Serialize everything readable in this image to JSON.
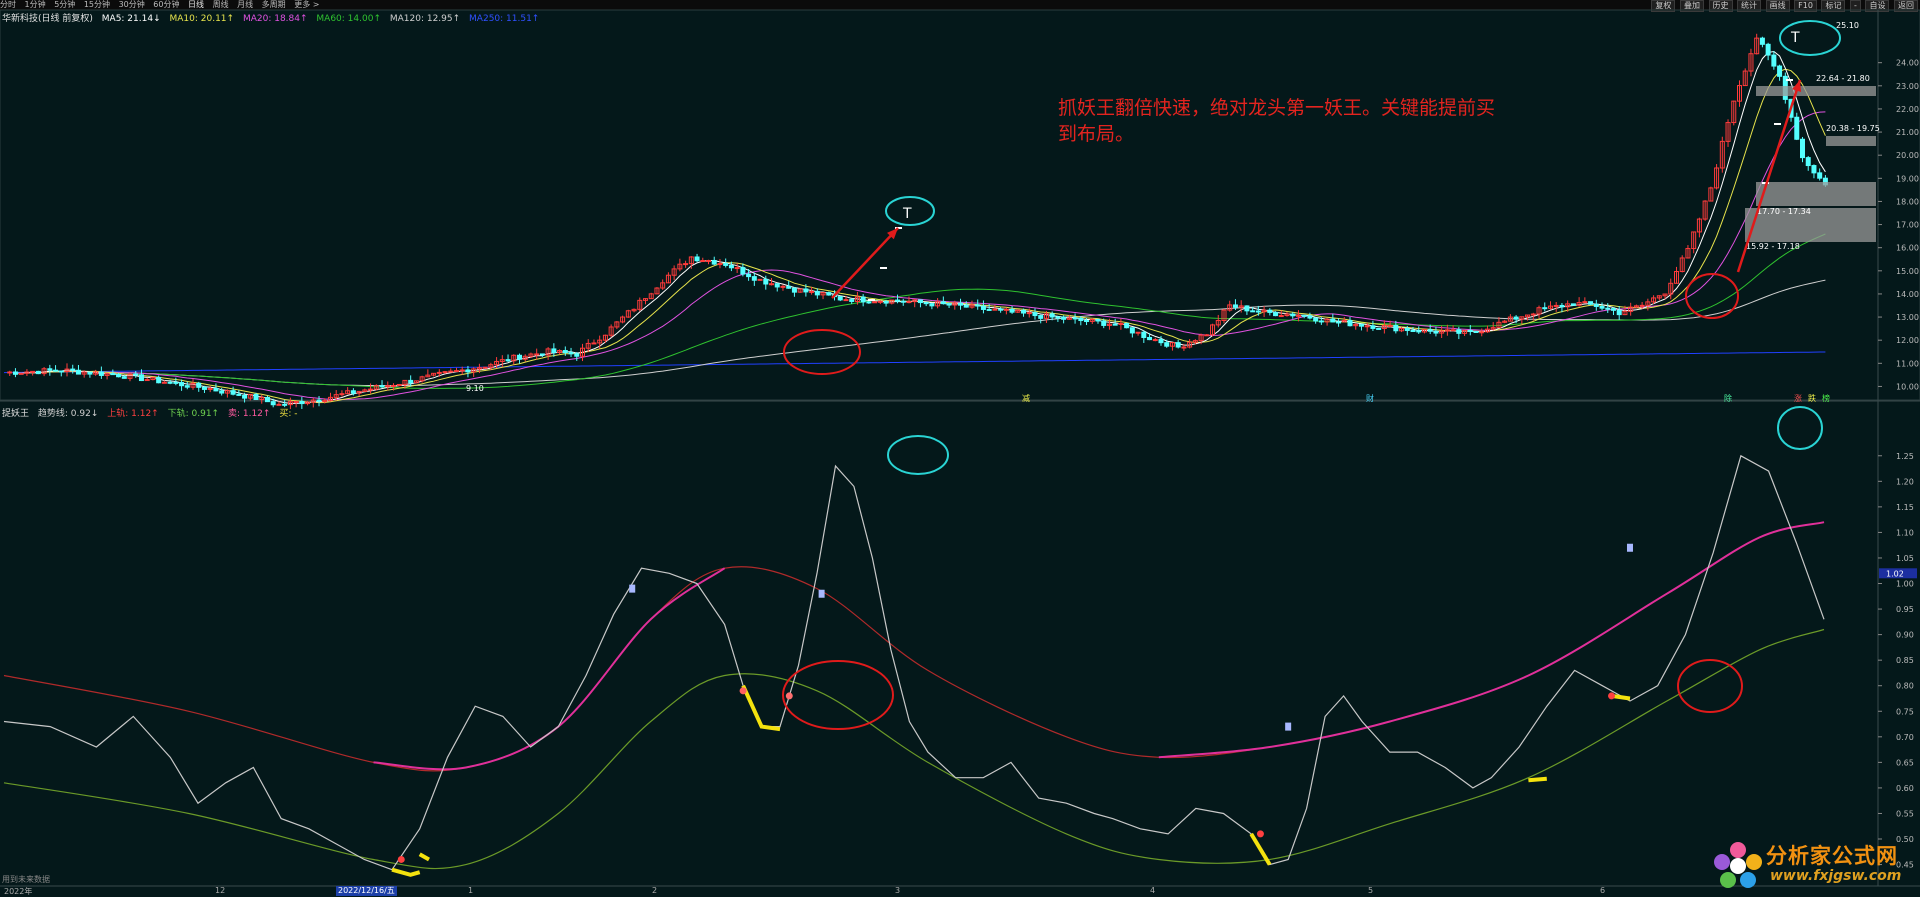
{
  "toolbar": {
    "periods": [
      "分时",
      "1分钟",
      "5分钟",
      "15分钟",
      "30分钟",
      "60分钟",
      "日线",
      "周线",
      "月线",
      "多周期",
      "更多 >"
    ],
    "active_period": "日线",
    "right_buttons": [
      "复权",
      "叠加",
      "历史",
      "统计",
      "画线",
      "F10",
      "标记",
      "-",
      "自设",
      "返回"
    ]
  },
  "main_header": {
    "stock": "华新科技(日线 前复权)",
    "ma5": "MA5: 21.14↓",
    "ma10": "MA10: 20.11↑",
    "ma20": "MA20: 18.84↑",
    "ma60": "MA60: 14.00↑",
    "ma120": "MA120: 12.95↑",
    "ma250": "MA250: 11.51↑"
  },
  "sub_header": {
    "name": "捉妖王",
    "trend": "趋势线: 0.92↓",
    "upper": "上轨: 1.12↑",
    "lower": "下轨: 0.91↑",
    "sell": "卖: 1.12↑",
    "buy": "买: -"
  },
  "annotation": "抓妖王翻倍快速，绝对龙头第一妖王。关键能提前买到布局。",
  "bottom_note": "用到未来数据",
  "date_box": "2022/12/16/五",
  "x_labels": [
    {
      "t": "2022年",
      "x": 4
    },
    {
      "t": "12",
      "x": 215
    },
    {
      "t": "1",
      "x": 468
    },
    {
      "t": "2",
      "x": 652
    },
    {
      "t": "3",
      "x": 895
    },
    {
      "t": "4",
      "x": 1150
    },
    {
      "t": "5",
      "x": 1368
    },
    {
      "t": "6",
      "x": 1600
    }
  ],
  "main_markers": [
    {
      "t": "减",
      "x": 1022,
      "c": "#f0f04a"
    },
    {
      "t": "财",
      "x": 1366,
      "c": "#4ad8ff"
    },
    {
      "t": "除",
      "x": 1724,
      "c": "#4af0a0"
    },
    {
      "t": "涨",
      "x": 1794,
      "c": "#ff5050"
    },
    {
      "t": "跌",
      "x": 1808,
      "c": "#f0f04a"
    },
    {
      "t": "榜",
      "x": 1822,
      "c": "#4af04a"
    }
  ],
  "price_labels": [
    {
      "t": "25.10",
      "x": 1836,
      "y": 28
    },
    {
      "t": "22.64 - 21.80",
      "x": 1816,
      "y": 81
    },
    {
      "t": "20.38 - 19.75",
      "x": 1826,
      "y": 131
    },
    {
      "t": "17.70 - 17.34",
      "x": 1757,
      "y": 214
    },
    {
      "t": "15.92 - 17.18",
      "x": 1746,
      "y": 249
    },
    {
      "t": "9.10",
      "x": 466,
      "y": 391
    }
  ],
  "watermark": {
    "name": "分析家公式网",
    "url": "www.fxjgsw.com"
  },
  "cursor_value": "1.02",
  "colors": {
    "background": "#04181a",
    "up": "#ff3b3b",
    "down": "#54ffff",
    "ma5": "#ffffff",
    "ma10": "#e7e34c",
    "ma20": "#e052e0",
    "ma60": "#2fc22f",
    "ma120": "#cfcfcf",
    "ma250": "#2040ff",
    "highlight": "#e01b1b",
    "cyan_circle": "#2ad4d4",
    "annotation": "#e3241f"
  },
  "chart_data": [
    {
      "type": "candlestick",
      "title": "华新科技(日线 前复权)",
      "ylim": [
        9.5,
        25.5
      ],
      "y_ticks": [
        10,
        11,
        12,
        13,
        14,
        15,
        16,
        17,
        18,
        19,
        20,
        21,
        22,
        23,
        24
      ],
      "x_ticks": [
        "2022年",
        "12",
        "1",
        "2",
        "3",
        "4",
        "5",
        "6"
      ],
      "price_marks": {
        "high": 25.1,
        "low": 9.1
      },
      "series": [
        {
          "name": "MA5",
          "value": 21.14
        },
        {
          "name": "MA10",
          "value": 20.11
        },
        {
          "name": "MA20",
          "value": 18.84
        },
        {
          "name": "MA60",
          "value": 14.0
        },
        {
          "name": "MA120",
          "value": 12.95
        },
        {
          "name": "MA250",
          "value": 11.51
        }
      ],
      "close_points": [
        [
          0,
          10.6
        ],
        [
          10,
          10.7
        ],
        [
          20,
          10.5
        ],
        [
          28,
          10.2
        ],
        [
          36,
          9.9
        ],
        [
          44,
          9.5
        ],
        [
          48,
          9.2
        ],
        [
          56,
          9.5
        ],
        [
          62,
          9.8
        ],
        [
          70,
          10.2
        ],
        [
          78,
          10.6
        ],
        [
          84,
          10.9
        ],
        [
          90,
          11.3
        ],
        [
          95,
          11.5
        ],
        [
          100,
          11.4
        ],
        [
          105,
          12.3
        ],
        [
          110,
          13.4
        ],
        [
          115,
          14.6
        ],
        [
          120,
          15.6
        ],
        [
          126,
          15.3
        ],
        [
          132,
          14.6
        ],
        [
          138,
          14.2
        ],
        [
          146,
          13.8
        ],
        [
          156,
          13.7
        ],
        [
          166,
          13.5
        ],
        [
          176,
          13.2
        ],
        [
          186,
          12.9
        ],
        [
          194,
          12.7
        ],
        [
          200,
          12.1
        ],
        [
          205,
          11.7
        ],
        [
          210,
          12.3
        ],
        [
          214,
          13.5
        ],
        [
          220,
          13.2
        ],
        [
          226,
          13.1
        ],
        [
          232,
          12.8
        ],
        [
          240,
          12.6
        ],
        [
          248,
          12.4
        ],
        [
          256,
          12.3
        ],
        [
          262,
          12.8
        ],
        [
          268,
          13.3
        ],
        [
          274,
          13.6
        ],
        [
          278,
          13.5
        ],
        [
          282,
          13.2
        ],
        [
          286,
          13.5
        ],
        [
          290,
          14.1
        ],
        [
          294,
          15.9
        ],
        [
          298,
          18.6
        ],
        [
          302,
          22.4
        ],
        [
          306,
          25.1
        ],
        [
          310,
          23.4
        ],
        [
          314,
          19.9
        ],
        [
          318,
          18.7
        ]
      ]
    },
    {
      "type": "line",
      "title": "捉妖王",
      "ylim": [
        0.41,
        1.32
      ],
      "y_ticks": [
        0.45,
        0.5,
        0.55,
        0.6,
        0.65,
        0.7,
        0.75,
        0.8,
        0.85,
        0.9,
        0.95,
        1.0,
        1.05,
        1.1,
        1.15,
        1.2,
        1.25
      ],
      "series": [
        {
          "name": "趋势线",
          "last": 0.92,
          "points": [
            [
              0,
              0.73
            ],
            [
              10,
              0.72
            ],
            [
              20,
              0.68
            ],
            [
              28,
              0.74
            ],
            [
              36,
              0.66
            ],
            [
              42,
              0.57
            ],
            [
              48,
              0.61
            ],
            [
              54,
              0.64
            ],
            [
              60,
              0.54
            ],
            [
              66,
              0.52
            ],
            [
              72,
              0.49
            ],
            [
              78,
              0.46
            ],
            [
              84,
              0.44
            ],
            [
              90,
              0.52
            ],
            [
              96,
              0.66
            ],
            [
              102,
              0.76
            ],
            [
              108,
              0.74
            ],
            [
              114,
              0.68
            ],
            [
              120,
              0.72
            ],
            [
              126,
              0.82
            ],
            [
              132,
              0.94
            ],
            [
              138,
              1.03
            ],
            [
              144,
              1.02
            ],
            [
              150,
              1.0
            ],
            [
              156,
              0.92
            ],
            [
              160,
              0.8
            ],
            [
              164,
              0.72
            ],
            [
              168,
              0.72
            ],
            [
              172,
              0.84
            ],
            [
              176,
              1.02
            ],
            [
              180,
              1.23
            ],
            [
              184,
              1.19
            ],
            [
              188,
              1.05
            ],
            [
              192,
              0.87
            ],
            [
              196,
              0.73
            ],
            [
              200,
              0.67
            ],
            [
              206,
              0.62
            ],
            [
              212,
              0.62
            ],
            [
              218,
              0.65
            ],
            [
              224,
              0.58
            ],
            [
              230,
              0.57
            ],
            [
              236,
              0.55
            ],
            [
              240,
              0.54
            ],
            [
              246,
              0.52
            ],
            [
              252,
              0.51
            ],
            [
              258,
              0.56
            ],
            [
              264,
              0.55
            ],
            [
              270,
              0.51
            ],
            [
              274,
              0.45
            ],
            [
              278,
              0.46
            ],
            [
              282,
              0.56
            ],
            [
              286,
              0.74
            ],
            [
              290,
              0.78
            ],
            [
              294,
              0.73
            ],
            [
              300,
              0.67
            ],
            [
              306,
              0.67
            ],
            [
              312,
              0.64
            ],
            [
              318,
              0.6
            ],
            [
              322,
              0.62
            ],
            [
              328,
              0.68
            ],
            [
              334,
              0.76
            ],
            [
              340,
              0.83
            ],
            [
              346,
              0.8
            ],
            [
              352,
              0.77
            ],
            [
              358,
              0.8
            ],
            [
              364,
              0.9
            ],
            [
              370,
              1.06
            ],
            [
              376,
              1.25
            ],
            [
              382,
              1.22
            ],
            [
              388,
              1.08
            ],
            [
              394,
              0.93
            ]
          ]
        },
        {
          "name": "上轨",
          "last": 1.12,
          "points": [
            [
              0,
              0.82
            ],
            [
              40,
              0.75
            ],
            [
              80,
              0.65
            ],
            [
              100,
              0.64
            ],
            [
              120,
              0.72
            ],
            [
              140,
              0.93
            ],
            [
              156,
              1.03
            ],
            [
              176,
              0.99
            ],
            [
              200,
              0.83
            ],
            [
              230,
              0.7
            ],
            [
              250,
              0.66
            ],
            [
              274,
              0.68
            ],
            [
              300,
              0.73
            ],
            [
              330,
              0.82
            ],
            [
              360,
              0.98
            ],
            [
              380,
              1.09
            ],
            [
              394,
              1.12
            ]
          ]
        },
        {
          "name": "下轨",
          "last": 0.91,
          "points": [
            [
              0,
              0.61
            ],
            [
              40,
              0.55
            ],
            [
              80,
              0.46
            ],
            [
              100,
              0.45
            ],
            [
              120,
              0.55
            ],
            [
              140,
              0.73
            ],
            [
              156,
              0.82
            ],
            [
              176,
              0.79
            ],
            [
              200,
              0.65
            ],
            [
              230,
              0.51
            ],
            [
              250,
              0.46
            ],
            [
              274,
              0.46
            ],
            [
              300,
              0.53
            ],
            [
              330,
              0.62
            ],
            [
              360,
              0.77
            ],
            [
              380,
              0.87
            ],
            [
              394,
              0.91
            ]
          ]
        }
      ],
      "x_ticks": [
        "2022年",
        "12",
        "1",
        "2",
        "3",
        "4",
        "5",
        "6"
      ]
    }
  ]
}
